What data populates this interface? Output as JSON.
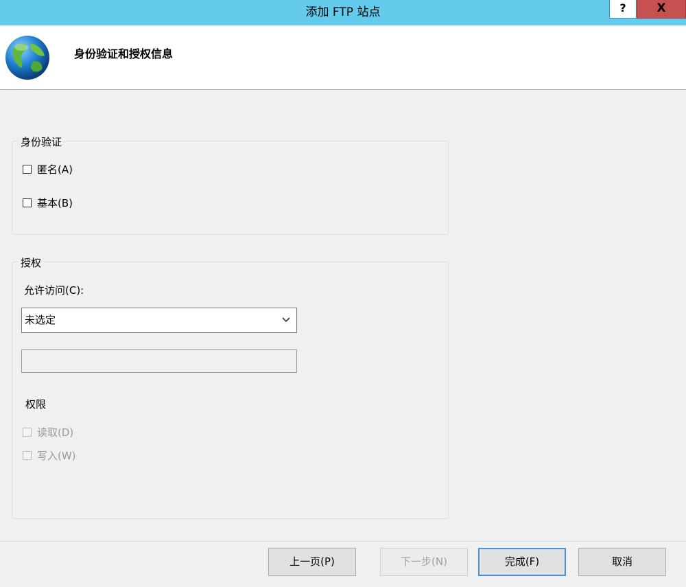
{
  "window": {
    "title": "添加 FTP 站点",
    "help_label": "?",
    "close_label": "X",
    "title_bar_color": "#65cbed",
    "close_color": "#c75050"
  },
  "header": {
    "icon": "globe-icon",
    "heading": "身份验证和授权信息"
  },
  "authentication": {
    "legend": "身份验证",
    "anonymous": {
      "label": "匿名(A)",
      "checked": false
    },
    "basic": {
      "label": "基本(B)",
      "checked": false
    }
  },
  "authorization": {
    "legend": "授权",
    "allow_access_label": "允许访问(C):",
    "allow_access_value": "未选定",
    "user_input_value": "",
    "permissions_label": "权限",
    "read": {
      "label": "读取(D)",
      "checked": false,
      "enabled": false
    },
    "write": {
      "label": "写入(W)",
      "checked": false,
      "enabled": false
    }
  },
  "footer": {
    "prev_label": "上一页(P)",
    "next_label": "下一步(N)",
    "finish_label": "完成(F)",
    "cancel_label": "取消"
  }
}
